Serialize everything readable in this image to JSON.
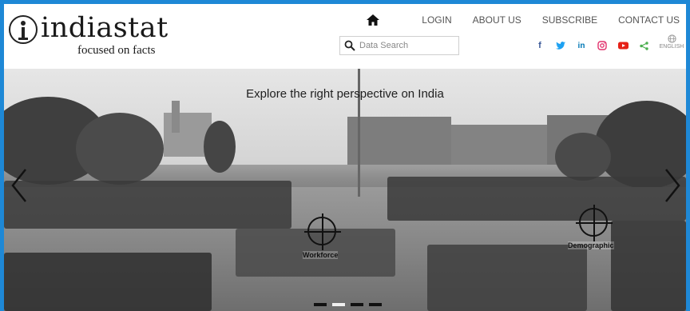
{
  "brand": {
    "name": "indiastat",
    "tagline": "focused on facts"
  },
  "nav": {
    "items": [
      "LOGIN",
      "ABOUT US",
      "SUBSCRIBE",
      "CONTACT US"
    ]
  },
  "search": {
    "placeholder": "Data Search"
  },
  "social": {
    "icons": [
      "facebook-icon",
      "twitter-icon",
      "linkedin-icon",
      "instagram-icon",
      "youtube-icon",
      "share-icon"
    ],
    "colors": {
      "facebook": "#3b5998",
      "twitter": "#1da1f2",
      "linkedin": "#0077b5",
      "instagram": "#e1306c",
      "youtube": "#e62117",
      "share": "#4caf50"
    }
  },
  "language": {
    "label": "ENGLISH"
  },
  "hero": {
    "title": "Explore the right perspective on India",
    "hotspots": [
      "Workforce",
      "Demographic"
    ],
    "slides": 4,
    "active_slide": 2
  },
  "colors": {
    "accent_border": "#1e88d6"
  }
}
